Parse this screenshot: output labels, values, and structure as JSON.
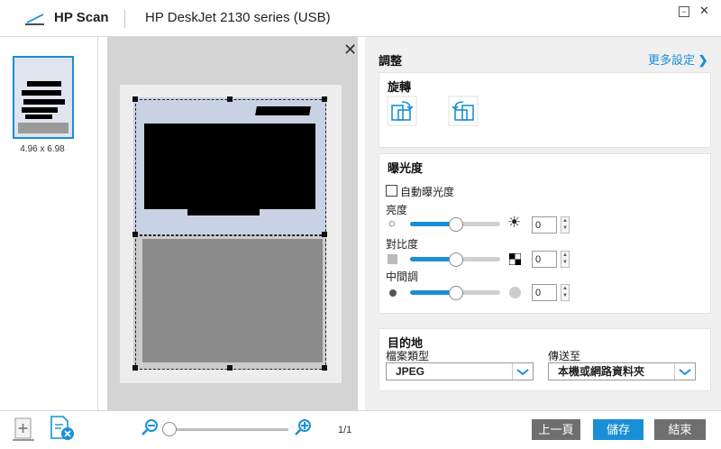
{
  "titlebar": {
    "app_name": "HP Scan",
    "device_name": "HP DeskJet 2130 series (USB)",
    "minimize": "−",
    "close": "✕"
  },
  "thumbnail": {
    "size_label": "4.96 x 6.98"
  },
  "preview": {
    "close_label": "✕"
  },
  "panel": {
    "title": "調整",
    "more_settings": "更多設定",
    "rotate": {
      "title": "旋轉"
    },
    "exposure": {
      "title": "曝光度",
      "auto_label": "自動曝光度",
      "auto_checked": false,
      "brightness_label": "亮度",
      "brightness_value": "0",
      "contrast_label": "對比度",
      "contrast_value": "0",
      "midtone_label": "中間調",
      "midtone_value": "0",
      "level_fraction": 0.5
    },
    "destination": {
      "title": "目的地",
      "filetype_label": "檔案類型",
      "filetype_value": "JPEG",
      "sendto_label": "傳送至",
      "sendto_value": "本機或網路資料夾"
    }
  },
  "bottom": {
    "page_count": "1/1",
    "prev_label": "上一頁",
    "save_label": "儲存",
    "finish_label": "結束"
  },
  "colors": {
    "accent": "#1a8fd6",
    "button_gray": "#6f6f6f"
  }
}
